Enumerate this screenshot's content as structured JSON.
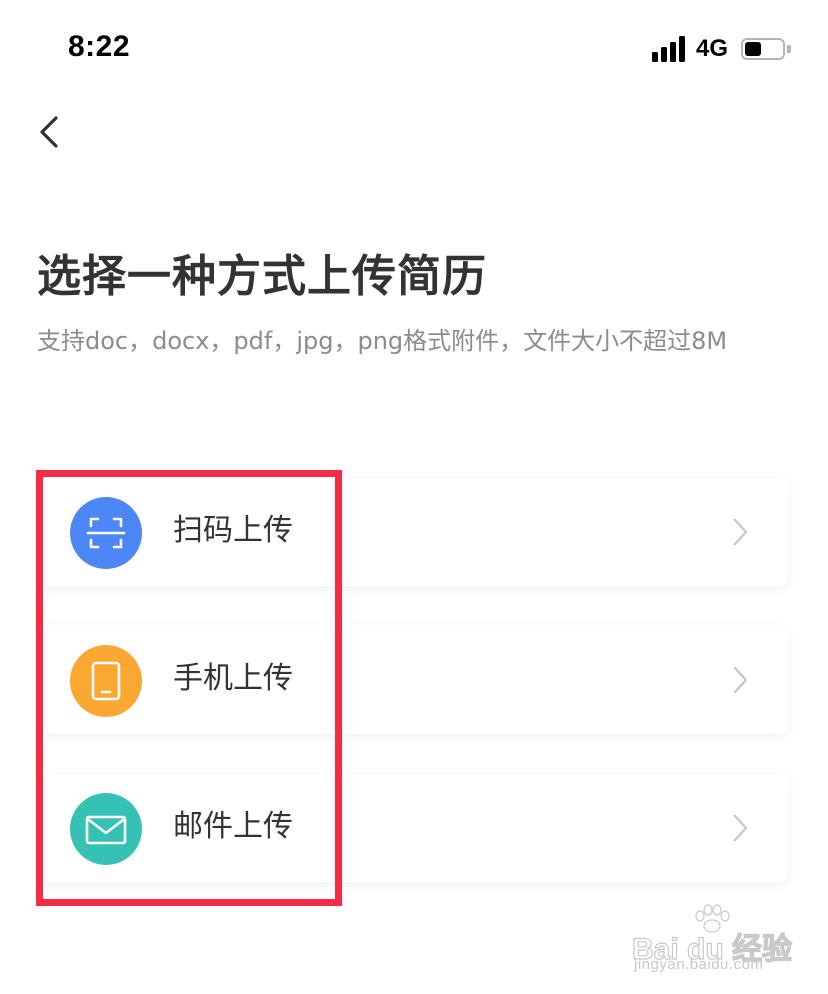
{
  "status_bar": {
    "time": "8:22",
    "network": "4G",
    "battery_level": 0.45,
    "signal_strength": 4
  },
  "header": {
    "back_icon": "chevron-left-icon"
  },
  "title": "选择一种方式上传简历",
  "subtitle": "支持doc，docx，pdf，jpg，png格式附件，文件大小不超过8M",
  "upload_options": [
    {
      "label": "扫码上传",
      "icon": "scan-icon",
      "color": "#4d86f6"
    },
    {
      "label": "手机上传",
      "icon": "phone-icon",
      "color": "#faa831"
    },
    {
      "label": "邮件上传",
      "icon": "mail-icon",
      "color": "#35c2b5"
    }
  ],
  "colors": {
    "title": "#333333",
    "subtitle": "#8c8c8c",
    "chevron": "#c8c8c8",
    "highlight_box": "#f62b46"
  },
  "watermark": {
    "brand": "Bai du 经验",
    "url": "jingyan.baidu.com"
  }
}
